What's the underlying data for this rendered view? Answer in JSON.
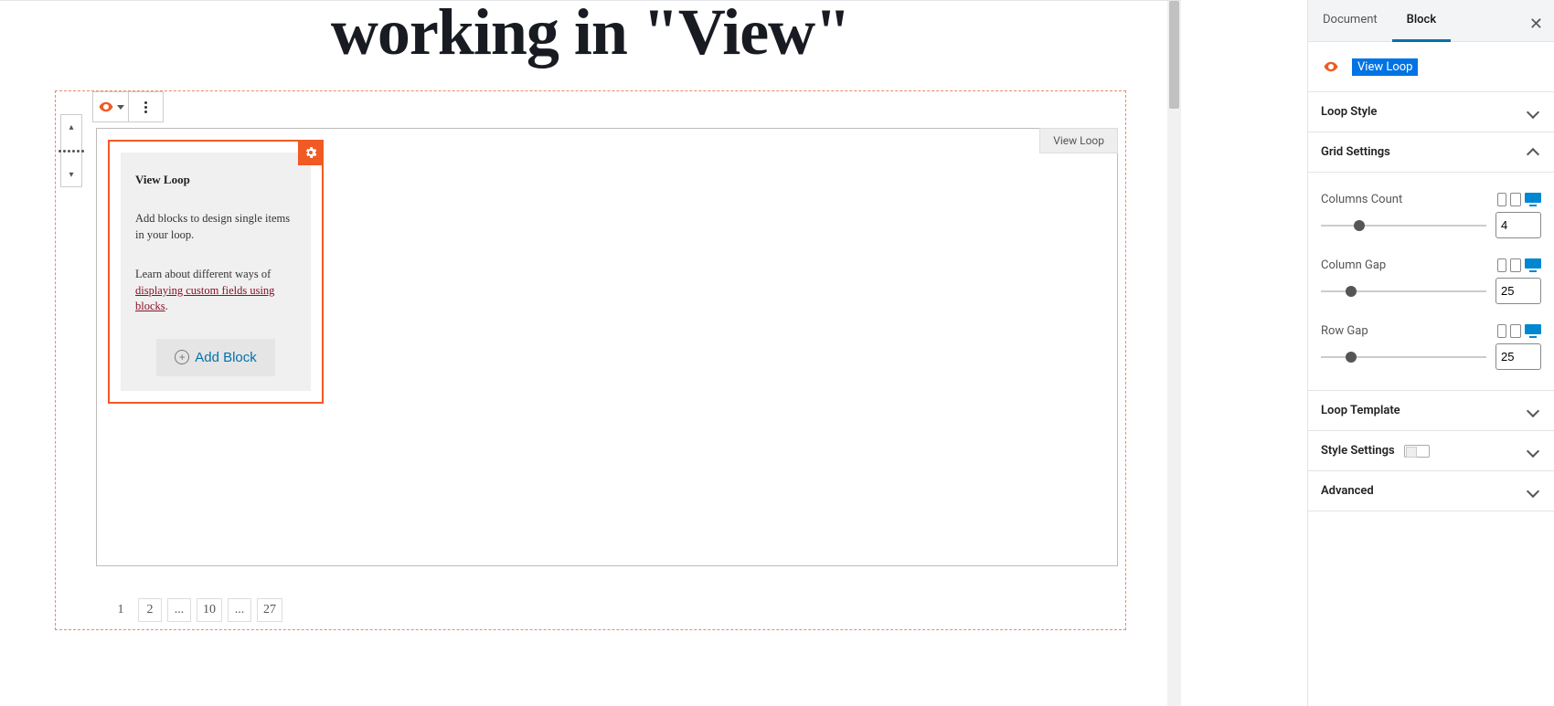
{
  "editor": {
    "title_line": "working in \"View\"",
    "block_toolbar": {
      "eye_label": "view-loop-icon"
    },
    "view_container_label": "View Loop",
    "loop_block": {
      "title": "View Loop",
      "desc": "Add blocks to design single items in your loop.",
      "learn_prefix": "Learn about different ways of ",
      "learn_link": "displaying custom fields using blocks",
      "learn_suffix": ".",
      "add_block_label": "Add Block"
    },
    "pagination": [
      "1",
      "2",
      "...",
      "10",
      "...",
      "27"
    ]
  },
  "sidebar": {
    "tabs": {
      "document": "Document",
      "block": "Block"
    },
    "block_name": "View Loop",
    "panels": {
      "loop_style": "Loop Style",
      "grid_settings": "Grid Settings",
      "loop_template": "Loop Template",
      "style_settings": "Style Settings",
      "advanced": "Advanced"
    },
    "grid": {
      "columns_count": {
        "label": "Columns Count",
        "value": "4"
      },
      "column_gap": {
        "label": "Column Gap",
        "value": "25"
      },
      "row_gap": {
        "label": "Row Gap",
        "value": "25"
      }
    }
  }
}
